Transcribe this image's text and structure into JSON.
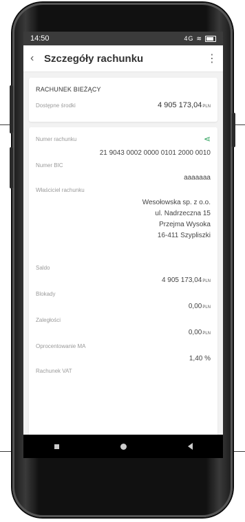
{
  "status_bar": {
    "time": "14:50",
    "signal": "4G"
  },
  "header": {
    "title": "Szczegóły rachunku"
  },
  "account_summary": {
    "type_label": "RACHUNEK BIEŻĄCY",
    "available_label": "Dostępne środki",
    "available_value": "4 905 173,04",
    "currency": "PLN"
  },
  "details": {
    "account_number_label": "Numer rachunku",
    "account_number": "21 9043 0002 0000 0101 2000 0010",
    "bic_label": "Numer BIC",
    "bic_value": "aaaaaaa",
    "owner_label": "Właściciel rachunku",
    "owner_lines": [
      "Wesołowska sp. z o.o.",
      "ul. Nadrzeczna 15",
      "Przejma Wysoka",
      "16-411 Szypliszki"
    ],
    "saldo_label": "Saldo",
    "saldo_value": "4 905 173,04",
    "blokady_label": "Blokady",
    "blokady_value": "0,00",
    "zaleglosci_label": "Zaległości",
    "zaleglosci_value": "0,00",
    "oprocentowanie_label": "Oprocentowanie MA",
    "oprocentowanie_value": "1,40 %",
    "vat_label": "Rachunek VAT",
    "currency": "PLN"
  },
  "colors": {
    "accent": "#2aa05a",
    "status_bar": "#3b3b3b"
  }
}
